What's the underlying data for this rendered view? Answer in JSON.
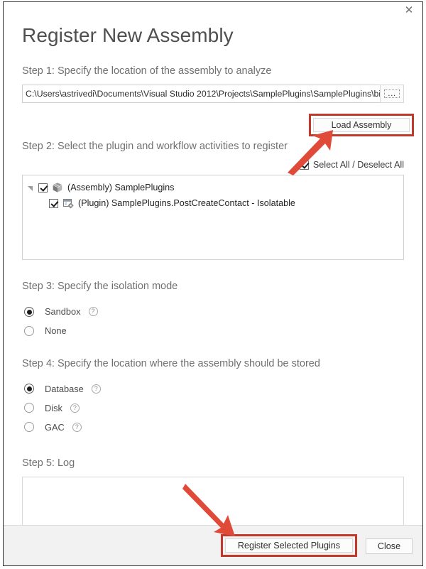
{
  "window": {
    "close_icon": "close-icon",
    "close_glyph": "✕"
  },
  "dialog": {
    "title": "Register New Assembly"
  },
  "steps": {
    "step1": {
      "label": "Step 1: Specify the location of the assembly to analyze",
      "path_value": "C:\\Users\\astrivedi\\Documents\\Visual Studio 2012\\Projects\\SamplePlugins\\SamplePlugins\\bin\\",
      "path_placeholder": "Assembly location",
      "browse_label": "...",
      "load_button_label": "Load Assembly"
    },
    "step2": {
      "label": "Step 2: Select the plugin and workflow activities to register",
      "select_all_label": "Select All / Deselect All",
      "select_all_checked": true,
      "tree": [
        {
          "icon": "assembly-package-icon",
          "label": "(Assembly) SamplePlugins",
          "checked": true,
          "level": 1,
          "expanded": true
        },
        {
          "icon": "plugin-window-gear-icon",
          "label": "(Plugin) SamplePlugins.PostCreateContact - Isolatable",
          "checked": true,
          "level": 2,
          "expanded": false
        }
      ]
    },
    "step3": {
      "label": "Step 3: Specify the isolation mode",
      "options": [
        {
          "label": "Sandbox",
          "selected": true,
          "help": true
        },
        {
          "label": "None",
          "selected": false,
          "help": false
        }
      ]
    },
    "step4": {
      "label": "Step 4: Specify the location where the assembly should be stored",
      "options": [
        {
          "label": "Database",
          "selected": true,
          "help": true
        },
        {
          "label": "Disk",
          "selected": false,
          "help": true
        },
        {
          "label": "GAC",
          "selected": false,
          "help": true
        }
      ]
    },
    "step5": {
      "label": "Step 5: Log",
      "log_value": "",
      "log_placeholder": ""
    }
  },
  "footer": {
    "register_label": "Register Selected Plugins",
    "close_label": "Close"
  },
  "annotations": {
    "highlight_color": "#c0392b",
    "arrow_color": "#e04a38",
    "arrows": [
      {
        "name": "arrow-to-load-assembly",
        "direction": "up-right"
      },
      {
        "name": "arrow-to-register-button",
        "direction": "down-right"
      }
    ]
  },
  "help_glyph": "?"
}
